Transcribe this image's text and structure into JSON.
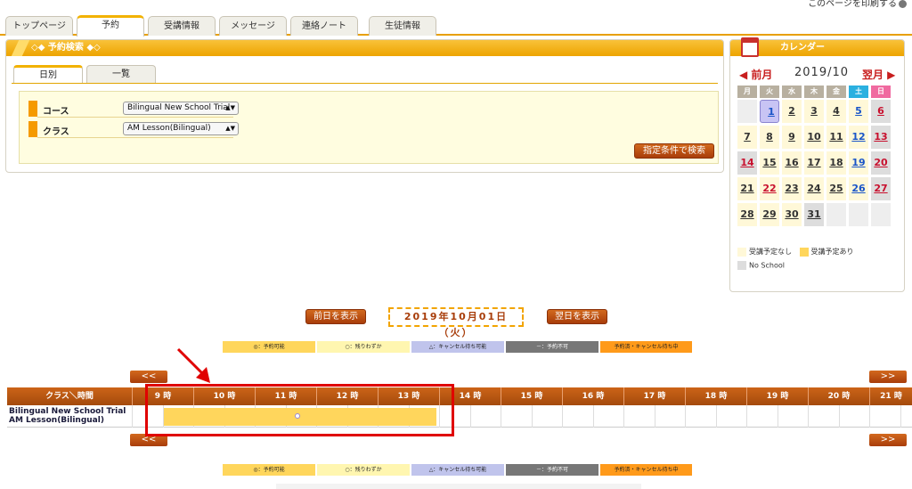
{
  "header": {
    "top_right_text": "このページを印刷する"
  },
  "tabs": [
    {
      "label": "トップページ",
      "active": false
    },
    {
      "label": "予約",
      "active": true
    },
    {
      "label": "受講情報",
      "active": false
    },
    {
      "label": "メッセージ",
      "active": false
    },
    {
      "label": "連絡ノート",
      "active": false
    },
    {
      "label": "生徒情報",
      "active": false
    }
  ],
  "search": {
    "title": "◇◆ 予約検索 ◆◇",
    "subtabs": [
      {
        "label": "日別",
        "active": true
      },
      {
        "label": "一覧",
        "active": false
      }
    ],
    "course_label": "コース",
    "course_value": "Bilingual New School Trial",
    "class_label": "クラス",
    "class_value": "AM Lesson(Bilingual)",
    "search_button": "指定条件で検索"
  },
  "calendar": {
    "title": "カレンダー",
    "prev": "◀ 前月",
    "next": "翌月 ▶",
    "month": "2019/10",
    "dow": [
      "月",
      "火",
      "水",
      "木",
      "金",
      "土",
      "日"
    ],
    "weeks": [
      [
        "",
        "1",
        "2",
        "3",
        "4",
        "5",
        "6"
      ],
      [
        "7",
        "8",
        "9",
        "10",
        "11",
        "12",
        "13"
      ],
      [
        "14",
        "15",
        "16",
        "17",
        "18",
        "19",
        "20"
      ],
      [
        "21",
        "22",
        "23",
        "24",
        "25",
        "26",
        "27"
      ],
      [
        "28",
        "29",
        "30",
        "31",
        "",
        "",
        ""
      ]
    ],
    "legend": {
      "none": "受講予定なし",
      "has": "受講予定あり",
      "no_school": "No School"
    }
  },
  "daynav": {
    "prev_day": "前日を表示",
    "date": "2019年10月01日（火）",
    "next_day": "翌日を表示"
  },
  "legend": [
    {
      "label": "◎：予約可能",
      "color": "#ffd65c"
    },
    {
      "label": "○：残りわずか",
      "color": "#fff6b0"
    },
    {
      "label": "△：キャンセル待ち可能",
      "color": "#c0c4ec"
    },
    {
      "label": "－：予約不可",
      "color": "#777777"
    },
    {
      "label": "予約済・キャンセル待ち中",
      "color": "#ff9a1a"
    }
  ],
  "timeline": {
    "prev": "<<",
    "next": ">>",
    "header_label": "クラス＼時間",
    "hours": [
      "9 時",
      "10 時",
      "11 時",
      "12 時",
      "13 時",
      "14 時",
      "15 時",
      "16 時",
      "17 時",
      "18 時",
      "19 時",
      "20 時",
      "21 時"
    ],
    "row_name_1": "Bilingual New School Trial",
    "row_name_2": "AM Lesson(Bilingual)",
    "slot_symbol": "◎"
  }
}
